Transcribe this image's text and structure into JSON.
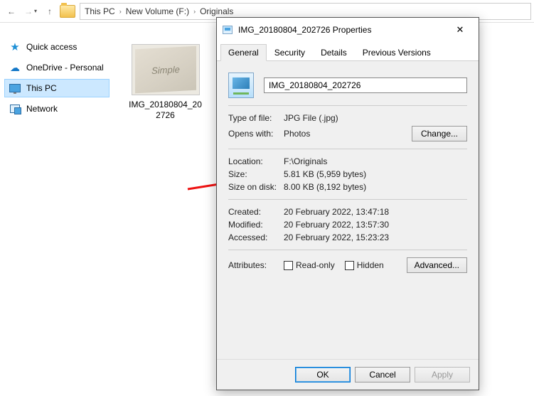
{
  "nav": {
    "crumbs": [
      "This PC",
      "New Volume (F:)",
      "Originals"
    ]
  },
  "tree": {
    "quick": "Quick access",
    "onedrive": "OneDrive - Personal",
    "thispc": "This PC",
    "network": "Network"
  },
  "file": {
    "name": "IMG_20180804_202726",
    "thumb_text": "Simple"
  },
  "dlg": {
    "title": "IMG_20180804_202726 Properties",
    "tabs": {
      "general": "General",
      "security": "Security",
      "details": "Details",
      "prev": "Previous Versions"
    },
    "filename": "IMG_20180804_202726",
    "labels": {
      "type": "Type of file:",
      "opens": "Opens with:",
      "location": "Location:",
      "size": "Size:",
      "sod": "Size on disk:",
      "created": "Created:",
      "modified": "Modified:",
      "accessed": "Accessed:",
      "attrs": "Attributes:"
    },
    "values": {
      "type": "JPG File (.jpg)",
      "opens": "Photos",
      "location": "F:\\Originals",
      "size": "5.81 KB (5,959 bytes)",
      "sod": "8.00 KB (8,192 bytes)",
      "created": "20 February 2022, 13:47:18",
      "modified": "20 February 2022, 13:57:30",
      "accessed": "20 February 2022, 15:23:23"
    },
    "chk": {
      "readonly": "Read-only",
      "hidden": "Hidden"
    },
    "btn": {
      "change": "Change...",
      "advanced": "Advanced...",
      "ok": "OK",
      "cancel": "Cancel",
      "apply": "Apply"
    }
  }
}
